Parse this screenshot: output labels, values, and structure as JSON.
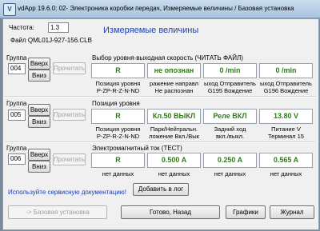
{
  "window": {
    "app_icon": "V",
    "title": "vdApp 19.6.0: 02- Электроника коробки передач,  Измеряемые величины / Базовая установка"
  },
  "header": {
    "heading": "Измеряемые величины",
    "frequency_label": "Частота:",
    "frequency_value": "1.3",
    "file_label": "Файл QML01J-927-156.CLB"
  },
  "groups": [
    {
      "group_label": "Группа",
      "number": "004",
      "up": "Вверх",
      "down": "Вниз",
      "read": "Прочитать",
      "title": "Выбор уровня-выходная скорость (ЧИТАТЬ ФАЙЛ)",
      "values": [
        "R",
        "не опознан",
        "0 /min",
        "0 /min"
      ],
      "captions": [
        [
          "Позиция уровня",
          "P-ZP-R-Z-N-ND"
        ],
        [
          "ражение направл",
          "Не распознан"
        ],
        [
          "ыход Отправитель",
          "G195 Вождение"
        ],
        [
          "ыход Отправитель",
          "G196 Вождение"
        ]
      ]
    },
    {
      "group_label": "Группа",
      "number": "005",
      "up": "Вверх",
      "down": "Вниз",
      "read": "Прочитать",
      "title": "Позиция уровня",
      "values": [
        "R",
        "Кл.50 ВЫКЛ",
        "Реле ВКЛ",
        "13.80 V"
      ],
      "captions": [
        [
          "Позиция уровня",
          "P-ZP-R-Z-N-ND"
        ],
        [
          "Парк/Нейтральн.",
          "ложение Вкл./Вык"
        ],
        [
          "Задний ход",
          "вкл./выкл."
        ],
        [
          "Питание V",
          "Терминал 15"
        ]
      ]
    },
    {
      "group_label": "Группа",
      "number": "006",
      "up": "Вверх",
      "down": "Вниз",
      "read": "Прочитать",
      "title": "Электромагнитный ток (ТЕСТ)",
      "values": [
        "R",
        "0.500 A",
        "0.250 A",
        "0.565 A"
      ],
      "captions": [
        [
          "нет данных"
        ],
        [
          "нет данных"
        ],
        [
          "нет данных"
        ],
        [
          "нет данных"
        ]
      ]
    }
  ],
  "footer": {
    "doc_notice": "Используйте сервисную документацию!",
    "add_log": "Добавить в лог",
    "basic_setting": "-> Базовая установка",
    "done_back": "Готово, Назад",
    "graphs": "Графики",
    "journal": "Журнал"
  }
}
